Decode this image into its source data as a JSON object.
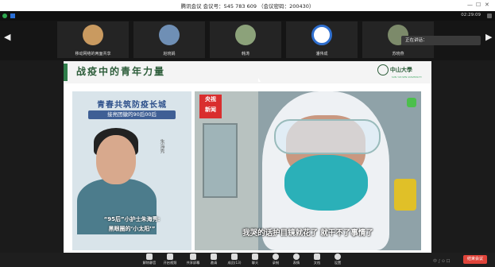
{
  "window": {
    "title": "腾讯会议 会议号：545 783 609 （会议密码：200430）",
    "controls": {
      "minimize": "—",
      "maximize": "☐",
      "close": "✕"
    }
  },
  "status": {
    "time": "02:29:09"
  },
  "participants": [
    {
      "name": "移动网络的两面共享",
      "avatar_color": "#c99a60"
    },
    {
      "name": "赵晓娟",
      "avatar_color": "#6f8fb5"
    },
    {
      "name": "韩涛",
      "avatar_color": "#8ca27a"
    },
    {
      "name": "潘伟成",
      "avatar_color": "#2f6fcf"
    },
    {
      "name": "苏晓燕",
      "avatar_color": "#7c8a6a"
    }
  ],
  "tooltip": "正在讲话：",
  "slide": {
    "title": "战疫中的青年力量",
    "logo_text": "中山大學",
    "logo_sub": "SUN YAT-SEN UNIVERSITY",
    "poster": {
      "headline": "青春共筑防疫长城",
      "subheadline": "接亮团徽的90后00后",
      "signature": "朱海秀",
      "quote_line1": "“95后”小护士朱海秀:",
      "quote_line2": "黑眼圈的‘小太阳’”"
    },
    "video": {
      "badge_line1": "央视",
      "badge_line2": "新闻",
      "subtitle": "我哭的话护目镜就花了 就干不了事情了"
    }
  },
  "toolbar": [
    {
      "label": "解除静音"
    },
    {
      "label": "开启视频"
    },
    {
      "label": "共享屏幕"
    },
    {
      "label": "邀请"
    },
    {
      "label": "成员(13)"
    },
    {
      "label": "聊天"
    },
    {
      "label": "录制"
    },
    {
      "label": "表情"
    },
    {
      "label": "文档"
    },
    {
      "label": "设置"
    }
  ],
  "end_button": "结束会议",
  "tray_text": "中 ∫ ⊙ 口"
}
